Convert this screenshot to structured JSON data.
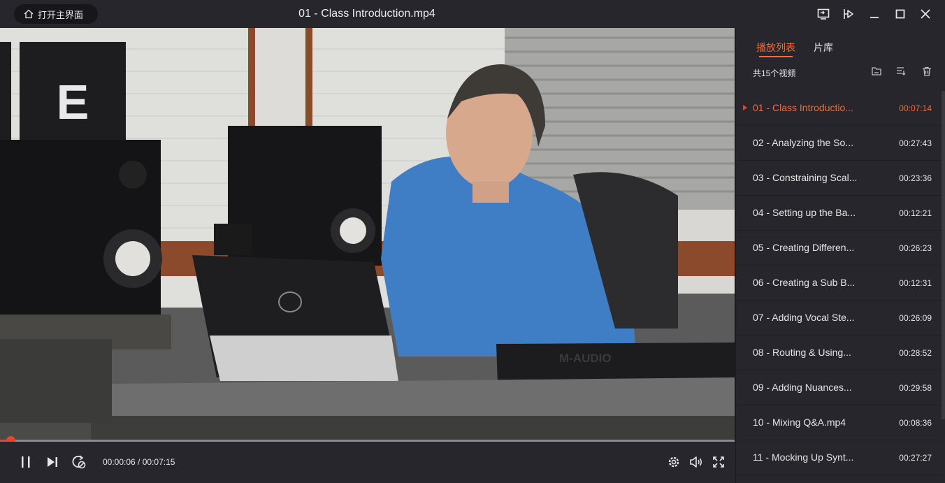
{
  "titlebar": {
    "home_label": "打开主界面",
    "title": "01 - Class Introduction.mp4",
    "controls": [
      "screen-icon",
      "pin-icon",
      "minimize-icon",
      "maximize-icon",
      "close-icon"
    ]
  },
  "video": {
    "sign_letter": "E",
    "keyboard_brand": "M-AUDIO"
  },
  "player": {
    "current_time": "00:00:06",
    "separator": " / ",
    "total_time": "00:07:15",
    "progress": 0.014
  },
  "sidebar": {
    "tabs": [
      {
        "label": "播放列表",
        "active": true
      },
      {
        "label": "片库",
        "active": false
      }
    ],
    "count": "共15个视频",
    "items": [
      {
        "name": "01 - Class Introductio...",
        "duration": "00:07:14",
        "active": true
      },
      {
        "name": "02 - Analyzing the So...",
        "duration": "00:27:43",
        "active": false
      },
      {
        "name": "03 - Constraining Scal...",
        "duration": "00:23:36",
        "active": false
      },
      {
        "name": "04 - Setting up the Ba...",
        "duration": "00:12:21",
        "active": false
      },
      {
        "name": "05 - Creating Differen...",
        "duration": "00:26:23",
        "active": false
      },
      {
        "name": "06 - Creating a Sub B...",
        "duration": "00:12:31",
        "active": false
      },
      {
        "name": "07 - Adding Vocal Ste...",
        "duration": "00:26:09",
        "active": false
      },
      {
        "name": "08 - Routing & Using...",
        "duration": "00:28:52",
        "active": false
      },
      {
        "name": "09 - Adding Nuances...",
        "duration": "00:29:58",
        "active": false
      },
      {
        "name": "10 - Mixing Q&A.mp4",
        "duration": "00:08:36",
        "active": false
      },
      {
        "name": "11 - Mocking Up Synt...",
        "duration": "00:27:27",
        "active": false
      }
    ]
  },
  "colors": {
    "accent": "#f26b3a",
    "background": "#26262c"
  }
}
